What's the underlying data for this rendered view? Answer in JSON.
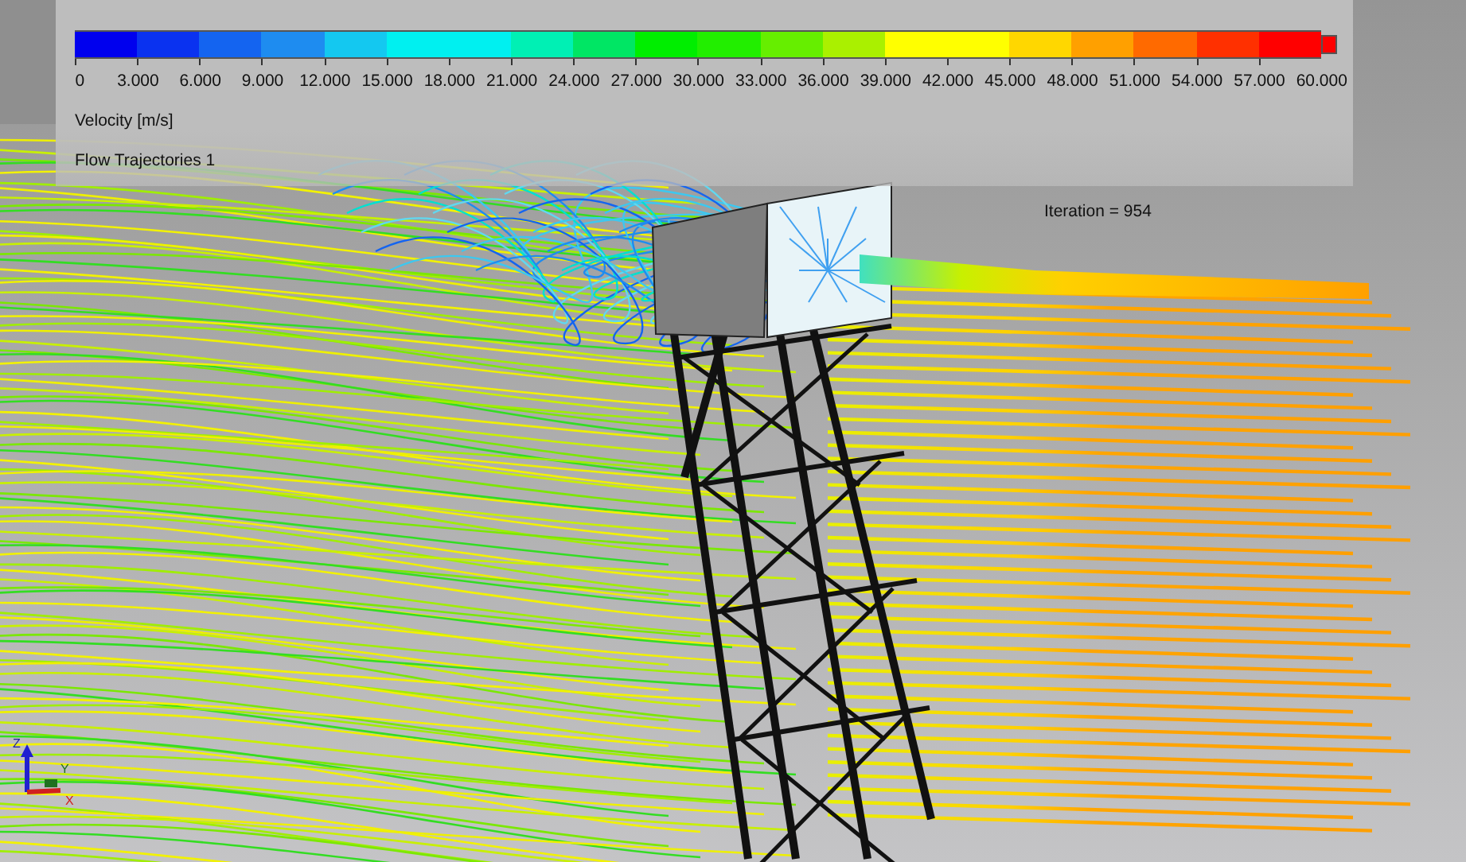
{
  "legend": {
    "segments": [
      {
        "color": "#0000ee"
      },
      {
        "color": "#0a32f0"
      },
      {
        "color": "#1464f0"
      },
      {
        "color": "#1e8cf0"
      },
      {
        "color": "#14c8f0"
      },
      {
        "color": "#00f0f0"
      },
      {
        "color": "#00f0f0"
      },
      {
        "color": "#00f0b4"
      },
      {
        "color": "#00e664"
      },
      {
        "color": "#00ee00"
      },
      {
        "color": "#22ee00"
      },
      {
        "color": "#66ee00"
      },
      {
        "color": "#aaf000"
      },
      {
        "color": "#ffff00"
      },
      {
        "color": "#ffff00"
      },
      {
        "color": "#ffd700"
      },
      {
        "color": "#ffa000"
      },
      {
        "color": "#ff6a00"
      },
      {
        "color": "#ff3000"
      },
      {
        "color": "#ff0000"
      }
    ],
    "ticks": [
      "0",
      "3.000",
      "6.000",
      "9.000",
      "12.000",
      "15.000",
      "18.000",
      "21.000",
      "24.000",
      "27.000",
      "30.000",
      "33.000",
      "36.000",
      "39.000",
      "42.000",
      "45.000",
      "48.000",
      "51.000",
      "54.000",
      "57.000",
      "60.000"
    ],
    "quantity": "Velocity [m/s]",
    "series_name": "Flow Trajectories 1"
  },
  "iteration": "Iteration = 954",
  "axis_triad": {
    "z": "Z",
    "y": "Y",
    "x": "X"
  }
}
